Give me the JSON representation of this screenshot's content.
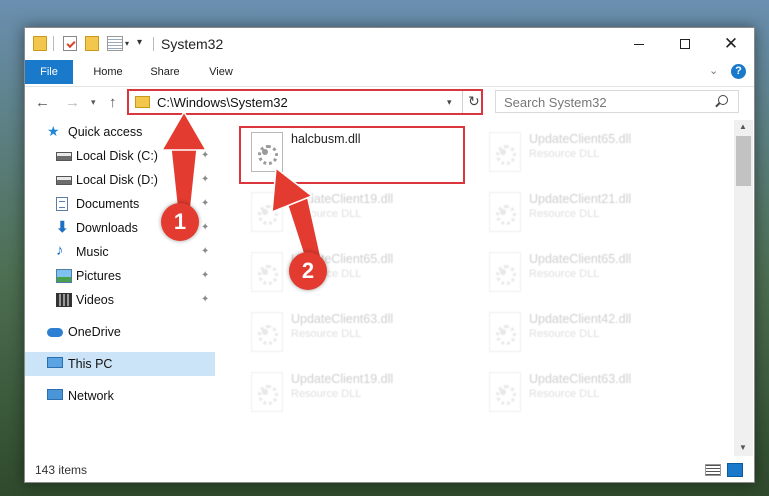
{
  "window": {
    "title": "System32",
    "qa_dropdown": "▾",
    "minimize_label": "",
    "maximize_label": "",
    "close_label": "✕"
  },
  "ribbon": {
    "tabs": [
      "File",
      "Home",
      "Share",
      "View"
    ],
    "expand_glyph": "⌄",
    "help_glyph": "?"
  },
  "address": {
    "back_glyph": "←",
    "forward_glyph": "→",
    "recent_glyph": "▾",
    "up_glyph": "↑",
    "path": "C:\\Windows\\System32",
    "dropdown_glyph": "▾",
    "refresh_glyph": "↻",
    "search_placeholder": "Search System32"
  },
  "nav_pane": {
    "items": [
      {
        "label": "Quick access",
        "icon": "star-icon",
        "pinned": false
      },
      {
        "label": "Local Disk (C:)",
        "icon": "drive-icon",
        "pinned": true
      },
      {
        "label": "Local Disk (D:)",
        "icon": "drive-icon",
        "pinned": true
      },
      {
        "label": "Documents",
        "icon": "documents-icon",
        "pinned": true
      },
      {
        "label": "Downloads",
        "icon": "download-icon",
        "pinned": true
      },
      {
        "label": "Music",
        "icon": "music-icon",
        "pinned": true
      },
      {
        "label": "Pictures",
        "icon": "pictures-icon",
        "pinned": true
      },
      {
        "label": "Videos",
        "icon": "videos-icon",
        "pinned": true
      },
      {
        "label": "OneDrive",
        "icon": "cloud-icon",
        "pinned": false
      },
      {
        "label": "This PC",
        "icon": "computer-icon",
        "pinned": false,
        "selected": true
      },
      {
        "label": "Network",
        "icon": "network-icon",
        "pinned": false
      }
    ],
    "pin_glyph": "📌"
  },
  "files": [
    {
      "name": "halcbusm.dll",
      "type": "",
      "highlighted": true
    },
    {
      "name": "UpdateClient65.dll",
      "type": "Resource DLL"
    },
    {
      "name": "UpdateClient19.dll",
      "type": "Resource DLL"
    },
    {
      "name": "UpdateClient21.dll",
      "type": "Resource DLL"
    },
    {
      "name": "UpdateClient65.dll",
      "type": "Resource DLL"
    },
    {
      "name": "UpdateClient65.dll",
      "type": "Resource DLL"
    },
    {
      "name": "UpdateClient63.dll",
      "type": "Resource DLL"
    },
    {
      "name": "UpdateClient42.dll",
      "type": "Resource DLL"
    },
    {
      "name": "UpdateClient19.dll",
      "type": "Resource DLL"
    },
    {
      "name": "UpdateClient63.dll",
      "type": "Resource DLL"
    }
  ],
  "status": {
    "item_count": "143 items"
  },
  "annotations": {
    "step1": "1",
    "step2": "2",
    "color": "#e33b2f"
  }
}
